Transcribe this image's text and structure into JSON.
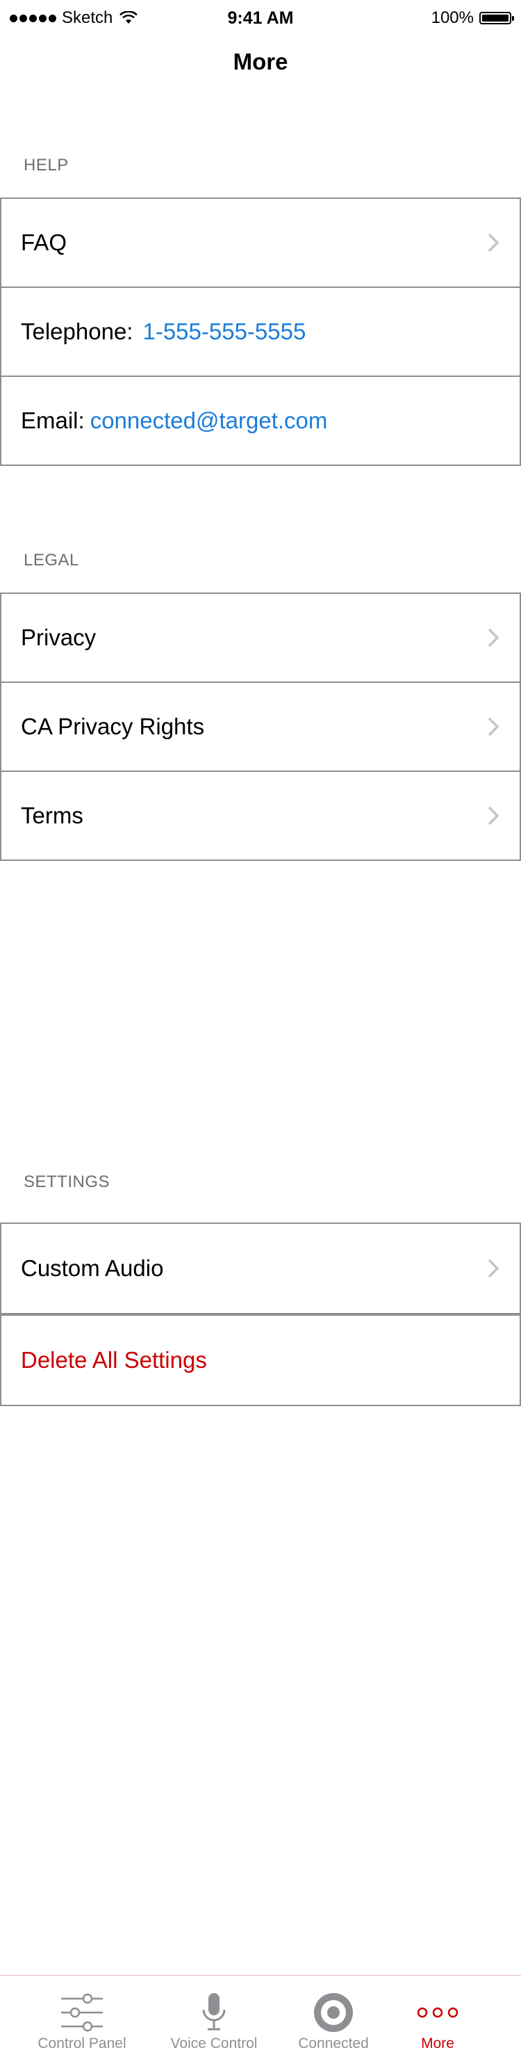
{
  "status_bar": {
    "carrier": "Sketch",
    "time": "9:41 AM",
    "battery_text": "100%"
  },
  "nav": {
    "title": "More"
  },
  "sections": {
    "help": {
      "header": "HELP",
      "faq": "FAQ",
      "telephone_label": "Telephone:",
      "telephone_value": "1-555-555-5555",
      "email_label": "Email:",
      "email_value": "connected@target.com"
    },
    "legal": {
      "header": "LEGAL",
      "privacy": "Privacy",
      "ca_privacy": "CA Privacy Rights",
      "terms": "Terms"
    },
    "settings": {
      "header": "SETTINGS",
      "custom_audio": "Custom Audio",
      "delete_all": "Delete All Settings"
    }
  },
  "tabs": [
    {
      "label": "Control Panel",
      "icon": "sliders-icon",
      "active": false
    },
    {
      "label": "Voice Control",
      "icon": "microphone-icon",
      "active": false
    },
    {
      "label": "Connected",
      "icon": "target-icon",
      "active": false
    },
    {
      "label": "More",
      "icon": "more-dots-icon",
      "active": true
    }
  ],
  "colors": {
    "link": "#1a7ddb",
    "danger": "#cc0000",
    "active_tab": "#cc0000",
    "inactive_tab": "#8e8e93"
  }
}
